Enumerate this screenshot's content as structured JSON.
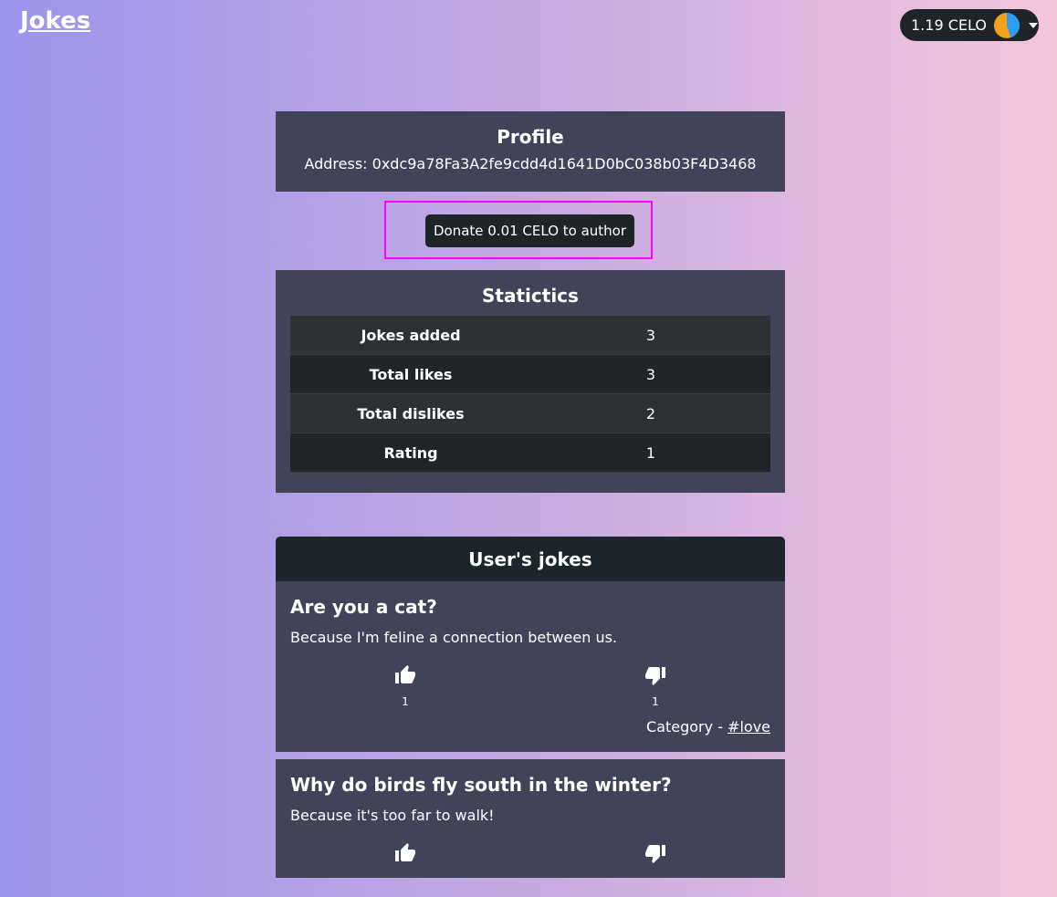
{
  "brand": "Jokes",
  "wallet": {
    "balance": "1.19 CELO"
  },
  "profile": {
    "title": "Profile",
    "address": "Address: 0xdc9a78Fa3A2fe9cdd4d1641D0bC038b03F4D3468"
  },
  "donate_label": "Donate 0.01 CELO to author",
  "stats": {
    "title": "Statictics",
    "rows": [
      {
        "label": "Jokes added",
        "value": "3"
      },
      {
        "label": "Total likes",
        "value": "3"
      },
      {
        "label": "Total dislikes",
        "value": "2"
      },
      {
        "label": "Rating",
        "value": "1"
      }
    ]
  },
  "jokes": {
    "header": "User's jokes",
    "items": [
      {
        "title": "Are you a cat?",
        "text": "Because I'm feline a connection between us.",
        "likes": "1",
        "dislikes": "1",
        "category_prefix": "Category - ",
        "category": "#love"
      },
      {
        "title": "Why do birds fly south in the winter?",
        "text": "Because it's too far to walk!"
      }
    ]
  },
  "colors": {
    "highlight": "#ff00ff",
    "card": "#414358",
    "dark": "#1f2428"
  },
  "icons": [
    "thumbs-up-icon",
    "thumbs-down-icon",
    "chevron-down-icon"
  ]
}
